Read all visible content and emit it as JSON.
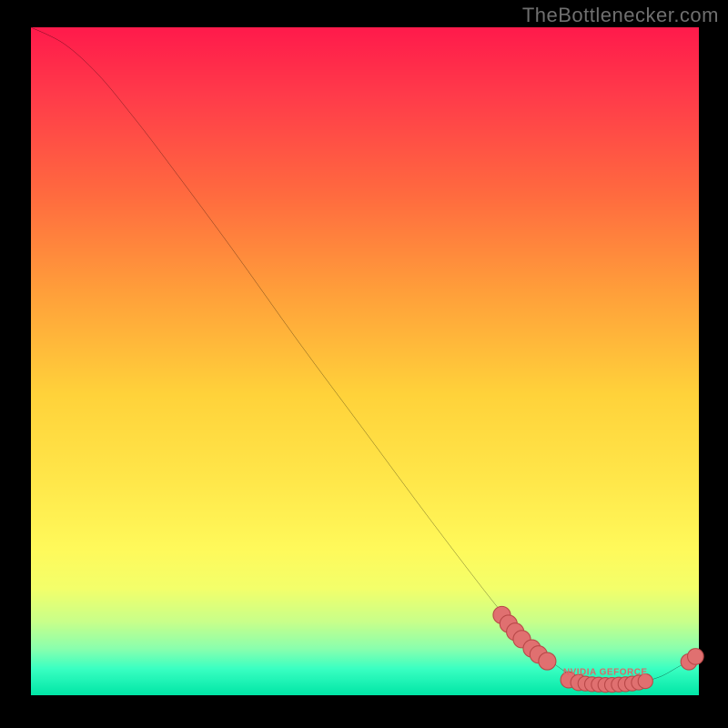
{
  "watermark": "TheBottlenecker.com",
  "colors": {
    "curve": "#000000",
    "dot_fill": "#e07070",
    "dot_stroke": "#b84848",
    "series_label": "#d86a6a"
  },
  "series_label": "NVIDIA GEFORCE",
  "chart_data": {
    "type": "line",
    "title": "",
    "xlabel": "",
    "ylabel": "",
    "xlim": [
      0,
      100
    ],
    "ylim": [
      0,
      100
    ],
    "curve": [
      {
        "x": 0,
        "y": 100
      },
      {
        "x": 5,
        "y": 97.5
      },
      {
        "x": 10,
        "y": 93
      },
      {
        "x": 15,
        "y": 87
      },
      {
        "x": 20,
        "y": 80.5
      },
      {
        "x": 30,
        "y": 67
      },
      {
        "x": 40,
        "y": 53
      },
      {
        "x": 50,
        "y": 39.5
      },
      {
        "x": 60,
        "y": 26
      },
      {
        "x": 70,
        "y": 13
      },
      {
        "x": 75,
        "y": 7.5
      },
      {
        "x": 80,
        "y": 3.5
      },
      {
        "x": 83,
        "y": 2
      },
      {
        "x": 86,
        "y": 1.5
      },
      {
        "x": 90,
        "y": 1.7
      },
      {
        "x": 94,
        "y": 2.7
      },
      {
        "x": 97,
        "y": 4.3
      },
      {
        "x": 100,
        "y": 6
      }
    ],
    "dots": [
      {
        "x": 70.5,
        "y": 12.0,
        "r": 1.3
      },
      {
        "x": 71.5,
        "y": 10.7,
        "r": 1.3
      },
      {
        "x": 72.5,
        "y": 9.5,
        "r": 1.3
      },
      {
        "x": 73.5,
        "y": 8.4,
        "r": 1.3
      },
      {
        "x": 75.0,
        "y": 7.0,
        "r": 1.3
      },
      {
        "x": 76.0,
        "y": 6.1,
        "r": 1.3
      },
      {
        "x": 77.3,
        "y": 5.1,
        "r": 1.3
      },
      {
        "x": 80.5,
        "y": 2.3,
        "r": 1.2
      },
      {
        "x": 82.0,
        "y": 1.9,
        "r": 1.2
      },
      {
        "x": 83.0,
        "y": 1.75,
        "r": 1.1
      },
      {
        "x": 84.0,
        "y": 1.65,
        "r": 1.1
      },
      {
        "x": 85.0,
        "y": 1.6,
        "r": 1.1
      },
      {
        "x": 86.0,
        "y": 1.55,
        "r": 1.1
      },
      {
        "x": 87.0,
        "y": 1.55,
        "r": 1.1
      },
      {
        "x": 88.0,
        "y": 1.6,
        "r": 1.1
      },
      {
        "x": 89.0,
        "y": 1.65,
        "r": 1.1
      },
      {
        "x": 90.0,
        "y": 1.75,
        "r": 1.1
      },
      {
        "x": 91.0,
        "y": 1.9,
        "r": 1.1
      },
      {
        "x": 92.0,
        "y": 2.1,
        "r": 1.1
      },
      {
        "x": 98.5,
        "y": 5.0,
        "r": 1.2
      },
      {
        "x": 99.5,
        "y": 5.8,
        "r": 1.2
      }
    ],
    "label_position": {
      "x": 86,
      "y": 3.4
    }
  }
}
